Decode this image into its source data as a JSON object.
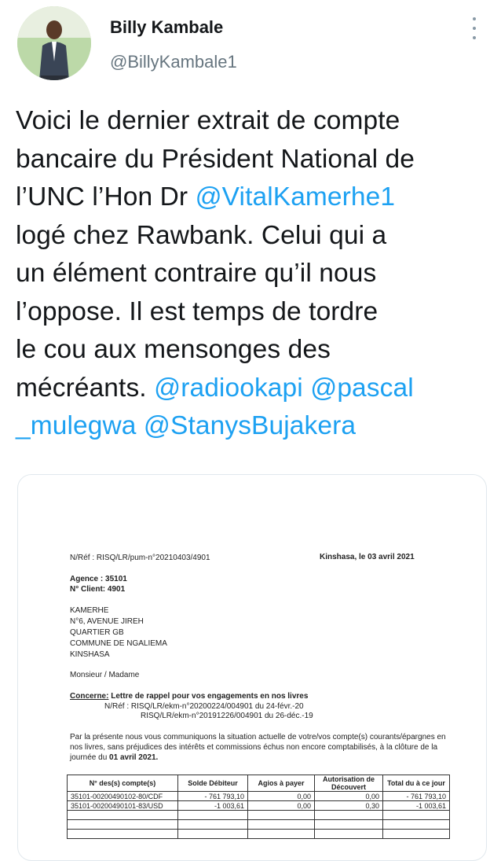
{
  "author": {
    "name": "Billy Kambale",
    "handle": "@BillyKambale1",
    "avatar_icon": "profile-photo"
  },
  "more_icon": "more-vertical-icon",
  "tweet": {
    "lines": [
      [
        {
          "t": "Voici le dernier extrait de compte"
        }
      ],
      [
        {
          "t": "bancaire du Président National de"
        }
      ],
      [
        {
          "t": "l’UNC l’Hon Dr "
        },
        {
          "t": "@VitalKamerhe1",
          "m": true
        }
      ],
      [
        {
          "t": "logé chez Rawbank. Celui qui a"
        }
      ],
      [
        {
          "t": "un élément contraire qu’il nous"
        }
      ],
      [
        {
          "t": "l’oppose. Il est temps de tordre"
        }
      ],
      [
        {
          "t": "le cou aux mensonges des"
        }
      ],
      [
        {
          "t": "mécréants. "
        },
        {
          "t": "@radiookapi",
          "m": true
        },
        {
          "t": " "
        },
        {
          "t": "@pascal",
          "m": true
        }
      ],
      [
        {
          "t": "_mulegwa",
          "m": true
        },
        {
          "t": " "
        },
        {
          "t": "@StanysBujakera",
          "m": true
        }
      ]
    ]
  },
  "document": {
    "ref": "N/Réf : RISQ/LR/pum-n°20210403/4901",
    "place_date": "Kinshasa, le 03 avril 2021",
    "agence": "Agence : 35101",
    "client": "N° Client: 4901",
    "address": [
      "KAMERHE",
      "N°6, AVENUE JIREH",
      "QUARTIER GB",
      "COMMUNE DE NGALIEMA",
      "KINSHASA"
    ],
    "salutation": "Monsieur / Madame",
    "concerne_label": "Concerne:",
    "concerne_text": "Lettre de rappel pour vos engagements en nos livres",
    "refs": [
      "N/Réf : RISQ/LR/ekm-n°20200224/004901 du 24-févr.-20",
      "RISQ/LR/ekm-n°20191226/004901 du 26-déc.-19"
    ],
    "body": [
      "Par la présente nous vous communiquons la situation actuelle de votre/vos compte(s) courants/épargnes en",
      "nos livres, sans préjudices des intérêts et commissions échus non encore comptabilisés, à la clôture de la"
    ],
    "body_last_prefix": "journée du ",
    "body_last_date": "01 avril 2021.",
    "table": {
      "headers": [
        "N° des(s) compte(s)",
        "Solde Débiteur",
        "Agios à payer",
        "Autorisation de Découvert",
        "Total du à ce jour"
      ],
      "rows": [
        [
          "35101-00200490102-80/CDF",
          "- 761 793,10",
          "0,00",
          "0,00",
          "- 761 793,10"
        ],
        [
          "35101-00200490101-83/USD",
          "-1 003,61",
          "0,00",
          "0,30",
          "-1 003,61"
        ],
        [
          "",
          "",
          "",
          "",
          ""
        ],
        [
          "",
          "",
          "",
          "",
          ""
        ],
        [
          "",
          "",
          "",
          "",
          ""
        ]
      ]
    }
  }
}
